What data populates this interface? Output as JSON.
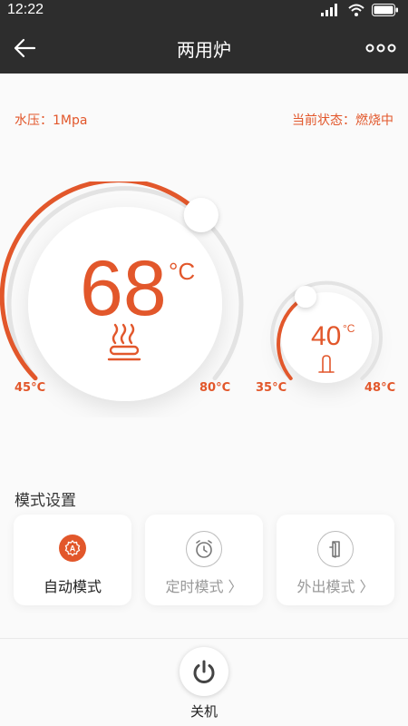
{
  "status_bar": {
    "time": "12:22"
  },
  "app_bar": {
    "title": "两用炉"
  },
  "info": {
    "water_pressure": "水压：1Mpa",
    "current_status": "当前状态：燃烧中"
  },
  "heating_dial": {
    "temperature": "68",
    "unit": "°C",
    "min_label": "45°C",
    "max_label": "80°C",
    "min": 45,
    "max": 80,
    "value": 68,
    "icon": "heating-radiator-icon"
  },
  "water_dial": {
    "temperature": "40",
    "unit": "°C",
    "min_label": "35°C",
    "max_label": "48°C",
    "min": 35,
    "max": 48,
    "value": 40,
    "icon": "faucet-icon"
  },
  "mode_section": {
    "title": "模式设置",
    "modes": [
      {
        "label": "自动模式",
        "active": true,
        "icon": "auto-mode-icon"
      },
      {
        "label": "定时模式 〉",
        "active": false,
        "icon": "alarm-clock-icon"
      },
      {
        "label": "外出模式 〉",
        "active": false,
        "icon": "door-exit-icon"
      }
    ]
  },
  "power": {
    "label": "关机",
    "icon": "power-icon"
  },
  "colors": {
    "accent": "#e2572b",
    "topbar": "#2d2d2d",
    "track": "#e3e3e3",
    "inactive": "#999999"
  }
}
